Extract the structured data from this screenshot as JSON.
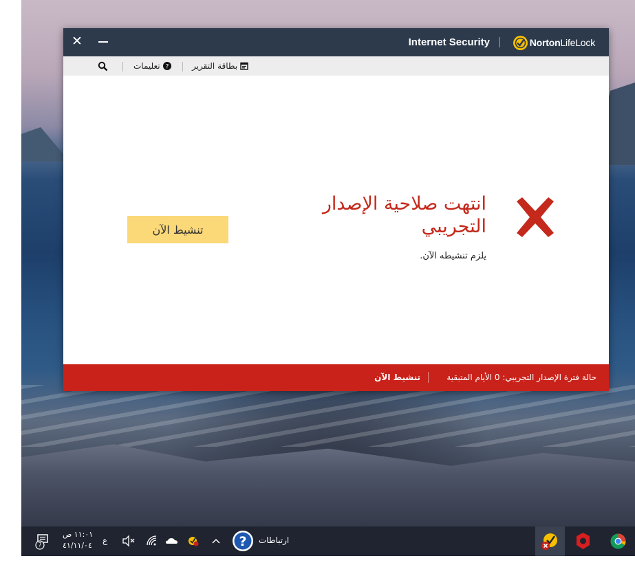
{
  "window": {
    "product_title": "Internet Security",
    "brand_name": "Norton",
    "brand_name_light": "LifeLock"
  },
  "toolbar": {
    "report_card": "بطاقة التقرير",
    "help": "تعليمات"
  },
  "content": {
    "headline_line1": "انتهت صلاحية الإصدار",
    "headline_line2": "التجريبي",
    "subtext": "يلزم تنشيطه الآن.",
    "activate_button": "تنشيط الآن"
  },
  "statusbar": {
    "trial_status": "حالة فترة الإصدار التجريبي:  0 الأيام المتبقية",
    "activate_link": "تنشيط الآن"
  },
  "taskbar": {
    "time": "١١:٠١ ص",
    "date": "٤١/١١/٠٤",
    "language": "ع",
    "links_label": "ارتباطات",
    "notification_count": "7"
  },
  "colors": {
    "titlebar": "#2c3a4b",
    "accent_red": "#c9221b",
    "button_yellow": "#fbd878",
    "brand_yellow": "#f7c000"
  }
}
